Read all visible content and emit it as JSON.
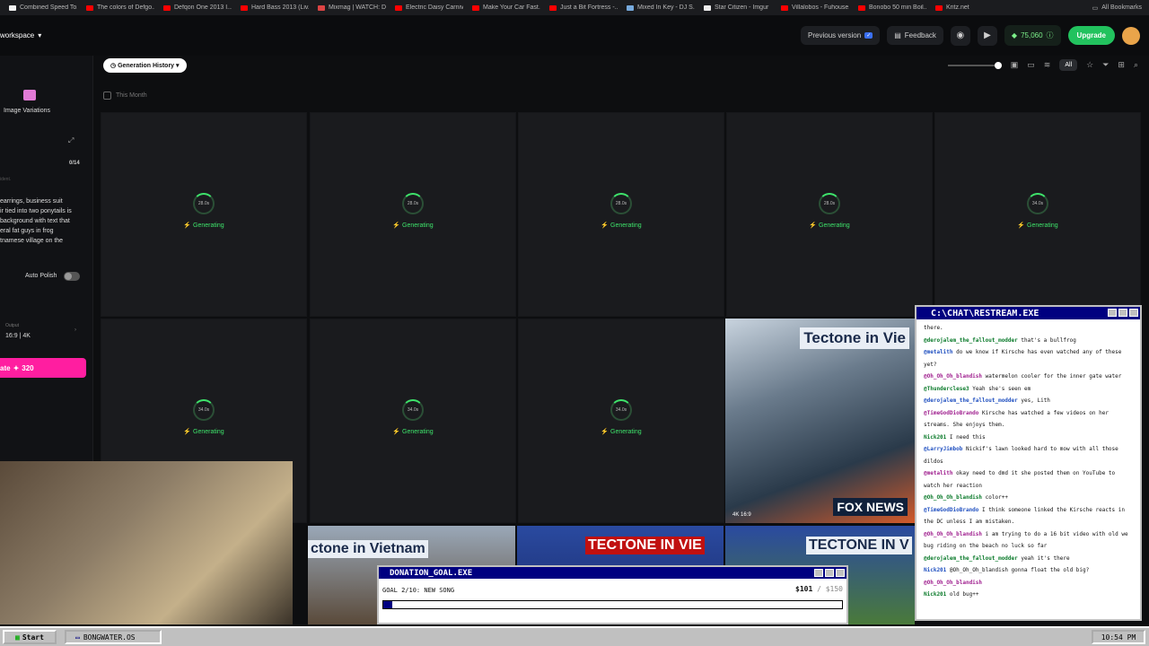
{
  "bookmarks": [
    {
      "label": "Combined Speed To...",
      "color": "#f2f2f2"
    },
    {
      "label": "The colors of Defgo...",
      "color": "#ff0000"
    },
    {
      "label": "Defqon One 2013 I...",
      "color": "#ff0000"
    },
    {
      "label": "Hard Bass 2013 (Liv...",
      "color": "#ff0000"
    },
    {
      "label": "Mixmag | WATCH: D...",
      "color": "#d44"
    },
    {
      "label": "Electric Daisy Carniv...",
      "color": "#ff0000"
    },
    {
      "label": "Make Your Car Fast...",
      "color": "#ff0000"
    },
    {
      "label": "Just a Bit Fortress -...",
      "color": "#ff0000"
    },
    {
      "label": "Mixed In Key - DJ S...",
      "color": "#7ad"
    },
    {
      "label": "Star Citizen - Imgur",
      "color": "#eee"
    },
    {
      "label": "Villalobos - Fuhouse...",
      "color": "#ff0000"
    },
    {
      "label": "Bonobo 50 min Boil...",
      "color": "#ff0000"
    },
    {
      "label": "Kritz.net",
      "color": "#ff0000"
    }
  ],
  "all_bookmarks": "All Bookmarks",
  "workspace": "workspace",
  "topbar": {
    "previous_version": "Previous version",
    "feedback": "Feedback",
    "tokens": "75,060",
    "upgrade": "Upgrade"
  },
  "sidebar": {
    "image_variations": "Image Variations",
    "counter": "0/14",
    "prompt": "earrings, business suit\nir tied into two ponytails is\nbackground with text that\neral fat guys in frog\ntnamese village on the",
    "placeholder": "ident.",
    "auto_polish": "Auto Polish",
    "output_label": "Output",
    "output_value": "16:9 | 4K",
    "generate": "ate",
    "generate_cost": "320"
  },
  "content": {
    "history": "Generation History",
    "this_month": "This Month",
    "all": "All"
  },
  "cards_row1": [
    {
      "time": "28.0s",
      "status": "Generating"
    },
    {
      "time": "28.0s",
      "status": "Generating"
    },
    {
      "time": "28.0s",
      "status": "Generating"
    },
    {
      "time": "28.0s",
      "status": "Generating"
    },
    {
      "time": "34.0s",
      "status": "Generating"
    }
  ],
  "cards_row2": [
    {
      "time": "34.0s",
      "status": "Generating"
    },
    {
      "time": "34.0s",
      "status": "Generating"
    },
    {
      "time": "34.0s",
      "status": "Generating"
    }
  ],
  "news_image": {
    "headline": "Tectone in Vie",
    "network": "FOX NEWS",
    "badge": "4K  16:9"
  },
  "strip": {
    "t1": "ctone in Vietnam",
    "t2": "TECTONE IN VIE",
    "t3": "TECTONE IN V"
  },
  "chat": {
    "title": "C:\\CHAT\\RESTREAM.EXE",
    "messages": [
      {
        "user": "",
        "text": "there."
      },
      {
        "user": "@derojalem_the_fallout_modder",
        "text": "that's a bullfrog"
      },
      {
        "user": "@metalith",
        "text": "do we know if Kirsche has even watched any of these yet?"
      },
      {
        "user": "@Oh_Oh_Oh_blandish",
        "text": "watermelon cooler for the inner gate water"
      },
      {
        "user": "@Thunderclese3",
        "text": "Yeah she's seen em"
      },
      {
        "user": "@derojalem_the_fallout_modder",
        "text": "yes, Lith"
      },
      {
        "user": "@TimeGodDioBrando",
        "text": "Kirsche has watched a few videos on her streams. She enjoys them."
      },
      {
        "user": "Nick201",
        "text": "I need this"
      },
      {
        "user": "@LarryJimbob",
        "text": "Nickif's lawn looked hard to mow with all those dildos"
      },
      {
        "user": "@metalith",
        "text": "okay need to dmd it she posted them on YouTube to watch her reaction"
      },
      {
        "user": "@Oh_Oh_Oh_blandish",
        "text": "color++"
      },
      {
        "user": "@TimeGodDioBrando",
        "text": "I think someone linked the Kirsche reacts in the DC unless I am mistaken."
      },
      {
        "user": "@Oh_Oh_Oh_blandish",
        "text": "i am trying to do a 16 bit video with old we bug riding on the beach no luck so far"
      },
      {
        "user": "@derojalem_the_fallout_modder",
        "text": "yeah it's there"
      },
      {
        "user": "Nick201",
        "text": "@Oh_Oh_Oh_blandish gonna float the old big?"
      },
      {
        "user": "@Oh_Oh_Oh_blandish",
        "text": ""
      },
      {
        "user": "Nick201",
        "text": "old bug++"
      }
    ]
  },
  "donation": {
    "title": "DONATION_GOAL.EXE",
    "goal": "GOAL 2/10: NEW SONG",
    "amount": "$101",
    "target": "/ $150",
    "progress": 0.02
  },
  "taskbar": {
    "start": "Start",
    "task": "BONGWATER.OS",
    "clock": "10:54 PM"
  },
  "colors": {
    "accent_green": "#22c25e",
    "generate_pink": "#ff1ea0",
    "win_blue": "#000080"
  }
}
